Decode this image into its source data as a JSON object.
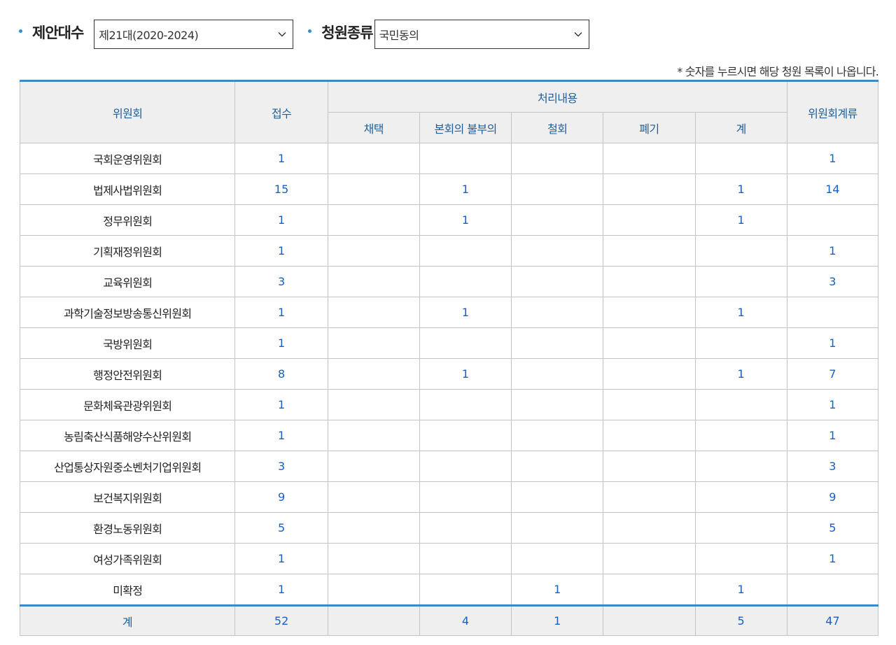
{
  "filters": {
    "session_label": "제안대수",
    "session_value": "제21대(2020-2024)",
    "type_label": "청원종류",
    "type_value": "국민동의"
  },
  "note": "* 숫자를 누르시면 해당 청원 목록이 나옵니다.",
  "table": {
    "headers": {
      "committee": "위원회",
      "received": "접수",
      "processing": "처리내용",
      "adopted": "채택",
      "not_referred": "본회의 불부의",
      "withdrawn": "철회",
      "discarded": "폐기",
      "subtotal": "계",
      "pending": "위원회계류"
    },
    "rows": [
      {
        "committee": "국회운영위원회",
        "received": "1",
        "adopted": "",
        "not_referred": "",
        "withdrawn": "",
        "discarded": "",
        "subtotal": "",
        "pending": "1"
      },
      {
        "committee": "법제사법위원회",
        "received": "15",
        "adopted": "",
        "not_referred": "1",
        "withdrawn": "",
        "discarded": "",
        "subtotal": "1",
        "pending": "14"
      },
      {
        "committee": "정무위원회",
        "received": "1",
        "adopted": "",
        "not_referred": "1",
        "withdrawn": "",
        "discarded": "",
        "subtotal": "1",
        "pending": ""
      },
      {
        "committee": "기획재정위원회",
        "received": "1",
        "adopted": "",
        "not_referred": "",
        "withdrawn": "",
        "discarded": "",
        "subtotal": "",
        "pending": "1"
      },
      {
        "committee": "교육위원회",
        "received": "3",
        "adopted": "",
        "not_referred": "",
        "withdrawn": "",
        "discarded": "",
        "subtotal": "",
        "pending": "3"
      },
      {
        "committee": "과학기술정보방송통신위원회",
        "received": "1",
        "adopted": "",
        "not_referred": "1",
        "withdrawn": "",
        "discarded": "",
        "subtotal": "1",
        "pending": ""
      },
      {
        "committee": "국방위원회",
        "received": "1",
        "adopted": "",
        "not_referred": "",
        "withdrawn": "",
        "discarded": "",
        "subtotal": "",
        "pending": "1"
      },
      {
        "committee": "행정안전위원회",
        "received": "8",
        "adopted": "",
        "not_referred": "1",
        "withdrawn": "",
        "discarded": "",
        "subtotal": "1",
        "pending": "7"
      },
      {
        "committee": "문화체육관광위원회",
        "received": "1",
        "adopted": "",
        "not_referred": "",
        "withdrawn": "",
        "discarded": "",
        "subtotal": "",
        "pending": "1"
      },
      {
        "committee": "농림축산식품해양수산위원회",
        "received": "1",
        "adopted": "",
        "not_referred": "",
        "withdrawn": "",
        "discarded": "",
        "subtotal": "",
        "pending": "1"
      },
      {
        "committee": "산업통상자원중소벤처기업위원회",
        "received": "3",
        "adopted": "",
        "not_referred": "",
        "withdrawn": "",
        "discarded": "",
        "subtotal": "",
        "pending": "3"
      },
      {
        "committee": "보건복지위원회",
        "received": "9",
        "adopted": "",
        "not_referred": "",
        "withdrawn": "",
        "discarded": "",
        "subtotal": "",
        "pending": "9"
      },
      {
        "committee": "환경노동위원회",
        "received": "5",
        "adopted": "",
        "not_referred": "",
        "withdrawn": "",
        "discarded": "",
        "subtotal": "",
        "pending": "5"
      },
      {
        "committee": "여성가족위원회",
        "received": "1",
        "adopted": "",
        "not_referred": "",
        "withdrawn": "",
        "discarded": "",
        "subtotal": "",
        "pending": "1"
      },
      {
        "committee": "미확정",
        "received": "1",
        "adopted": "",
        "not_referred": "",
        "withdrawn": "1",
        "discarded": "",
        "subtotal": "1",
        "pending": ""
      }
    ],
    "total": {
      "committee": "계",
      "received": "52",
      "adopted": "",
      "not_referred": "4",
      "withdrawn": "1",
      "discarded": "",
      "subtotal": "5",
      "pending": "47"
    }
  },
  "colors": {
    "accent": "#3b89c9",
    "link": "#1660c7",
    "header_text": "#1f5f99",
    "header_bg": "#efefef"
  },
  "icons": {
    "bullet": "bullet-dot-icon",
    "dropdown": "chevron-down-icon"
  }
}
